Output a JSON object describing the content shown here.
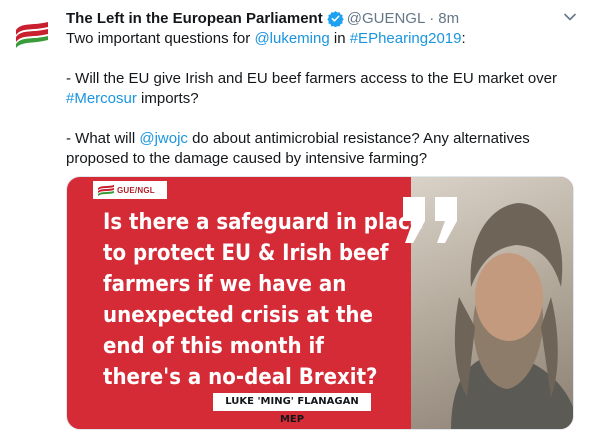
{
  "tweet": {
    "display_name": "The Left in the European Parliament",
    "handle": "@GUENGL",
    "separator": "·",
    "time": "8m",
    "text": {
      "p1_intro": "Two important questions for ",
      "p1_mention": "@lukeming",
      "p1_mid": " in ",
      "p1_hashtag": "#EPhearing2019",
      "p1_end": ":",
      "p2_start": "- Will the EU give Irish and EU beef farmers access to the EU market over ",
      "p2_hashtag": "#Mercosur",
      "p2_end": " imports?",
      "p3_start": "- What will ",
      "p3_mention": "@jwojc",
      "p3_end": " do about antimicrobial resistance? Any alternatives proposed to the damage caused by intensive farming?"
    }
  },
  "media": {
    "logo_text": "GUE/NGL",
    "quote_lines": [
      "Is there a safeguard in place",
      "to protect EU & Irish beef",
      "farmers if we have an",
      "unexpected crisis at the",
      "end of this month if",
      "there's a no-deal Brexit?"
    ],
    "speaker": "LUKE 'MING' FLANAGAN MEP"
  },
  "colors": {
    "link": "#1b95e0",
    "card_red": "#d52b36",
    "verified_blue": "#1da1f2",
    "logo_red": "#c8202f",
    "logo_green": "#3a9b3a"
  },
  "icons": {
    "avatar": "gue-ngl-flag-logo",
    "verified": "verified-badge-icon",
    "caret": "chevron-down-icon",
    "quote": "quote-marks-icon"
  }
}
